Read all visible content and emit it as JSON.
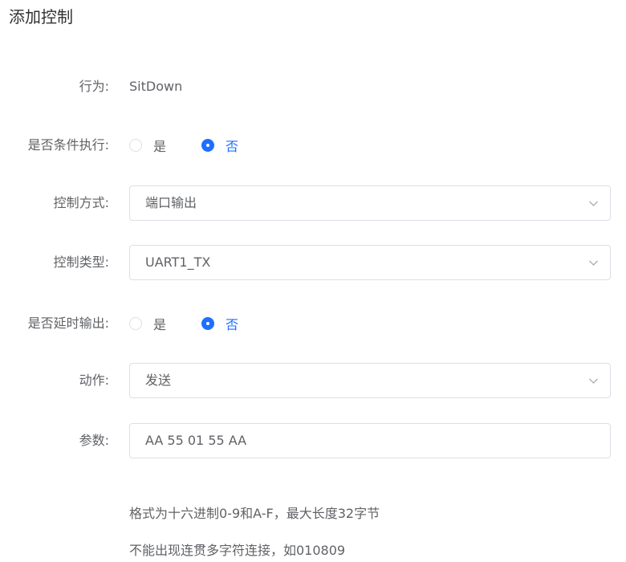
{
  "title": "添加控制",
  "fields": {
    "behavior": {
      "label": "行为:",
      "value": "SitDown"
    },
    "conditional": {
      "label": "是否条件执行:",
      "options": [
        "是",
        "否"
      ],
      "selected": "否"
    },
    "control_mode": {
      "label": "控制方式:",
      "value": "端口输出"
    },
    "control_type": {
      "label": "控制类型:",
      "value": "UART1_TX"
    },
    "delayed_output": {
      "label": "是否延时输出:",
      "options": [
        "是",
        "否"
      ],
      "selected": "否"
    },
    "action": {
      "label": "动作:",
      "value": "发送"
    },
    "params": {
      "label": "参数:",
      "value": "AA 55 01 55 AA"
    }
  },
  "hints": [
    "格式为十六进制0-9和A-F，最大长度32字节",
    "不能出现连贯多字符连接，如010809"
  ],
  "colors": {
    "accent": "#1e6fff",
    "border": "#dcdfe6",
    "text": "#606266"
  },
  "icons": {
    "dropdown": "chevron-down-icon"
  }
}
